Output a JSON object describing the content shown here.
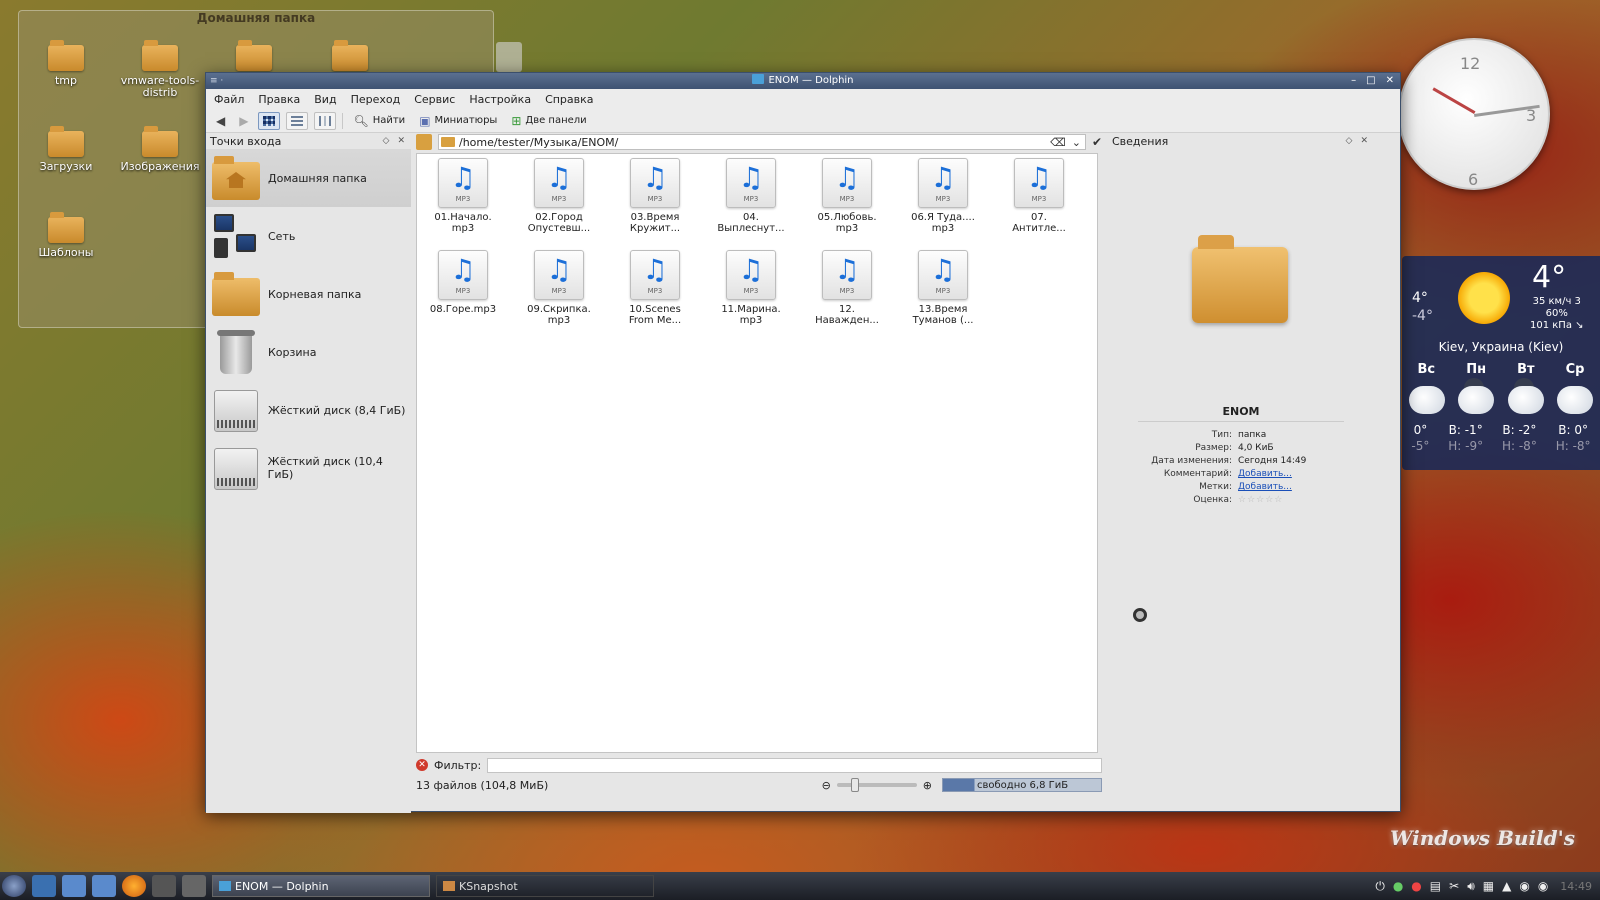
{
  "desktop": {
    "folder_view_title": "Домашняя папка",
    "icons": [
      {
        "label": "tmp"
      },
      {
        "label": "vmware-tools-distrib"
      },
      {
        "label": ""
      },
      {
        "label": ""
      },
      {
        "label": "Загрузки"
      },
      {
        "label": "Изображения"
      },
      {
        "label": "Шаблоны"
      }
    ]
  },
  "clock": {
    "n12": "12",
    "n3": "3",
    "n6": "6"
  },
  "weather": {
    "current": "4°",
    "high": "4°",
    "low": "-4°",
    "wind": "35 км/ч 3",
    "humidity": "60%",
    "pressure": "101 кПа ↘",
    "location": "Kiev, Украина (Kiev)",
    "days": [
      "Вс",
      "Пн",
      "Вт",
      "Ср"
    ],
    "forecast": [
      {
        "hi": "0°",
        "lo": "-5°"
      },
      {
        "hi": "В: -1°",
        "lo": "Н: -9°"
      },
      {
        "hi": "В: -2°",
        "lo": "Н: -8°"
      },
      {
        "hi": "В: 0°",
        "lo": "Н: -8°"
      }
    ]
  },
  "watermark": "Windows Build's",
  "window": {
    "title": "ENOM — Dolphin",
    "menu": [
      "Файл",
      "Правка",
      "Вид",
      "Переход",
      "Сервис",
      "Настройка",
      "Справка"
    ],
    "toolbar": {
      "search_label": "Найти",
      "preview_label": "Миниатюры",
      "split_label": "Две панели"
    },
    "places": {
      "title": "Точки входа",
      "items": [
        {
          "label": "Домашняя папка"
        },
        {
          "label": "Сеть"
        },
        {
          "label": "Корневая папка"
        },
        {
          "label": "Корзина"
        },
        {
          "label": "Жёсткий диск (8,4 ГиБ)"
        },
        {
          "label": "Жёсткий диск (10,4 ГиБ)"
        }
      ]
    },
    "location": "/home/tester/Музыка/ENOM/",
    "files": [
      {
        "l1": "01.Начало.",
        "l2": "mp3"
      },
      {
        "l1": "02.Город",
        "l2": "Опустевш..."
      },
      {
        "l1": "03.Время",
        "l2": "Кружит..."
      },
      {
        "l1": "04.",
        "l2": "Выплеснут..."
      },
      {
        "l1": "05.Любовь.",
        "l2": "mp3"
      },
      {
        "l1": "06.Я Туда....",
        "l2": "mp3"
      },
      {
        "l1": "07.",
        "l2": "Антитле..."
      },
      {
        "l1": "08.Горе.mp3",
        "l2": ""
      },
      {
        "l1": "09.Скрипка.",
        "l2": "mp3"
      },
      {
        "l1": "10.Scenes",
        "l2": "From Me..."
      },
      {
        "l1": "11.Марина.",
        "l2": "mp3"
      },
      {
        "l1": "12.",
        "l2": "Наважден..."
      },
      {
        "l1": "13.Время",
        "l2": "Туманов (..."
      }
    ],
    "file_tag": "MP3",
    "filter_label": "Фильтр:",
    "status": "13 файлов (104,8 МиБ)",
    "free_space": "свободно 6,8 ГиБ",
    "info": {
      "title": "Сведения",
      "name": "ENOM",
      "props": [
        {
          "k": "Тип:",
          "v": "папка"
        },
        {
          "k": "Размер:",
          "v": "4,0 КиБ"
        },
        {
          "k": "Дата изменения:",
          "v": "Сегодня 14:49"
        },
        {
          "k": "Комментарий:",
          "v": "Добавить..."
        },
        {
          "k": "Метки:",
          "v": "Добавить..."
        },
        {
          "k": "Оценка:",
          "v": "☆☆☆☆☆"
        }
      ]
    }
  },
  "taskbar": {
    "tasks": [
      {
        "label": "ENOM — Dolphin"
      },
      {
        "label": "KSnapshot"
      }
    ],
    "clock": "14:49"
  }
}
